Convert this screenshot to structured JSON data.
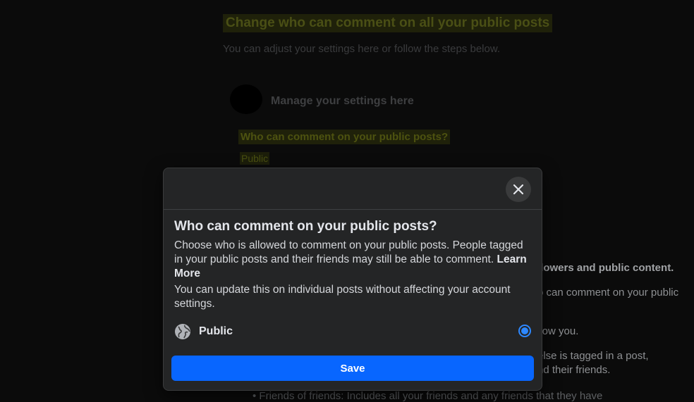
{
  "background": {
    "title": "Change who can comment on all your public posts",
    "subtitle": "You can adjust your settings here or follow the steps below.",
    "manage_label": "Manage your settings here",
    "question": "Who can comment on your public posts?",
    "current_value": "Public",
    "fragments": [
      "llowers and public content.",
      "o can comment on your public",
      "llow you.",
      " else is tagged in a post,",
      "nd their friends."
    ],
    "bullet_text": "Friends of friends: Includes all your friends and any friends that they have"
  },
  "modal": {
    "title": "Who can comment on your public posts?",
    "description": "Choose who is allowed to comment on your public posts. People tagged in your public posts and their friends may still be able to comment.",
    "learn_more": "Learn More",
    "note": "You can update this on individual posts without affecting your account settings.",
    "option": {
      "label": "Public",
      "icon": "globe-icon",
      "selected": true
    },
    "save_label": "Save",
    "close_icon": "close-icon"
  },
  "colors": {
    "accent": "#0866ff",
    "radio": "#2d88ff",
    "modal_bg": "#242526"
  }
}
